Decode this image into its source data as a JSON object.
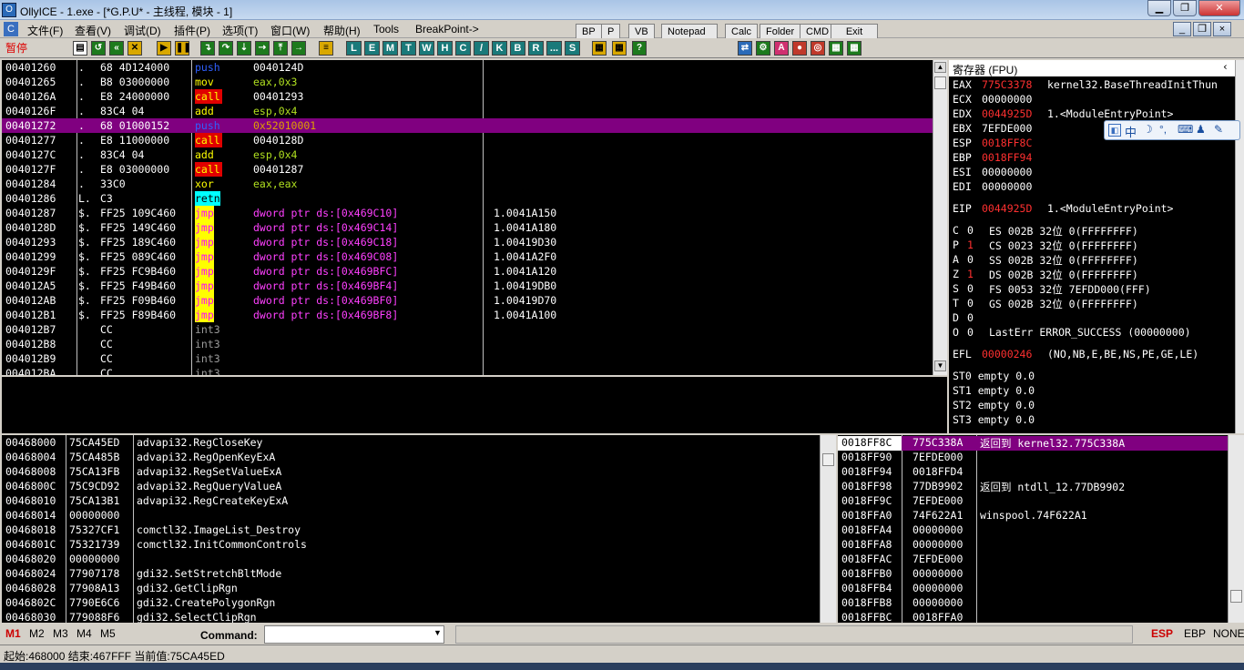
{
  "window": {
    "title": "OllyICE - 1.exe - [*G.P.U* - 主线程, 模块 - 1]"
  },
  "menu": [
    "文件(F)",
    "查看(V)",
    "调试(D)",
    "插件(P)",
    "选项(T)",
    "窗口(W)",
    "帮助(H)",
    "Tools",
    "BreakPoint->"
  ],
  "top_buttons": [
    "BP",
    "P",
    "VB",
    "Notepad",
    "Calc",
    "Folder",
    "CMD",
    "Exit"
  ],
  "status_state": "暂停",
  "toolbar_letters": [
    "L",
    "E",
    "M",
    "T",
    "W",
    "H",
    "C",
    "/",
    "K",
    "B",
    "R",
    "...",
    "S"
  ],
  "disasm": [
    {
      "addr": "00401260",
      "mark": ".",
      "hex": "68 4D124000",
      "mn": "push",
      "op": "0040124D",
      "cm": "",
      "style": "push"
    },
    {
      "addr": "00401265",
      "mark": ".",
      "hex": "B8 03000000",
      "mn": "mov",
      "op": "eax,0x3",
      "cm": "",
      "style": "plain"
    },
    {
      "addr": "0040126A",
      "mark": ".",
      "hex": "E8 24000000",
      "mn": "call",
      "op": "00401293",
      "cm": "",
      "style": "call"
    },
    {
      "addr": "0040126F",
      "mark": ".",
      "hex": "83C4 04",
      "mn": "add",
      "op": "esp,0x4",
      "cm": "",
      "style": "plain"
    },
    {
      "addr": "00401272",
      "mark": ".",
      "hex": "68 01000152",
      "mn": "push",
      "op": "0x52010001",
      "cm": "",
      "style": "sel"
    },
    {
      "addr": "00401277",
      "mark": ".",
      "hex": "E8 11000000",
      "mn": "call",
      "op": "0040128D",
      "cm": "",
      "style": "call"
    },
    {
      "addr": "0040127C",
      "mark": ".",
      "hex": "83C4 04",
      "mn": "add",
      "op": "esp,0x4",
      "cm": "",
      "style": "plain"
    },
    {
      "addr": "0040127F",
      "mark": ".",
      "hex": "E8 03000000",
      "mn": "call",
      "op": "00401287",
      "cm": "",
      "style": "call"
    },
    {
      "addr": "00401284",
      "mark": ".",
      "hex": "33C0",
      "mn": "xor",
      "op": "eax,eax",
      "cm": "",
      "style": "plain"
    },
    {
      "addr": "00401286",
      "mark": "L.",
      "hex": "C3",
      "mn": "retn",
      "op": "",
      "cm": "",
      "style": "retn"
    },
    {
      "addr": "00401287",
      "mark": "$.",
      "hex": "FF25 109C460",
      "mn": "jmp",
      "op": "dword ptr ds:[0x469C10]",
      "cm": "1.0041A150",
      "style": "jmp"
    },
    {
      "addr": "0040128D",
      "mark": "$.",
      "hex": "FF25 149C460",
      "mn": "jmp",
      "op": "dword ptr ds:[0x469C14]",
      "cm": "1.0041A180",
      "style": "jmp"
    },
    {
      "addr": "00401293",
      "mark": "$.",
      "hex": "FF25 189C460",
      "mn": "jmp",
      "op": "dword ptr ds:[0x469C18]",
      "cm": "1.00419D30",
      "style": "jmp"
    },
    {
      "addr": "00401299",
      "mark": "$.",
      "hex": "FF25 089C460",
      "mn": "jmp",
      "op": "dword ptr ds:[0x469C08]",
      "cm": "1.0041A2F0",
      "style": "jmp"
    },
    {
      "addr": "0040129F",
      "mark": "$.",
      "hex": "FF25 FC9B460",
      "mn": "jmp",
      "op": "dword ptr ds:[0x469BFC]",
      "cm": "1.0041A120",
      "style": "jmp"
    },
    {
      "addr": "004012A5",
      "mark": "$.",
      "hex": "FF25 F49B460",
      "mn": "jmp",
      "op": "dword ptr ds:[0x469BF4]",
      "cm": "1.00419DB0",
      "style": "jmp"
    },
    {
      "addr": "004012AB",
      "mark": "$.",
      "hex": "FF25 F09B460",
      "mn": "jmp",
      "op": "dword ptr ds:[0x469BF0]",
      "cm": "1.00419D70",
      "style": "jmp"
    },
    {
      "addr": "004012B1",
      "mark": "$.",
      "hex": "FF25 F89B460",
      "mn": "jmp",
      "op": "dword ptr ds:[0x469BF8]",
      "cm": "1.0041A100",
      "style": "jmp"
    },
    {
      "addr": "004012B7",
      "mark": "",
      "hex": "CC",
      "mn": "int3",
      "op": "",
      "cm": "",
      "style": "int3"
    },
    {
      "addr": "004012B8",
      "mark": "",
      "hex": "CC",
      "mn": "int3",
      "op": "",
      "cm": "",
      "style": "int3"
    },
    {
      "addr": "004012B9",
      "mark": "",
      "hex": "CC",
      "mn": "int3",
      "op": "",
      "cm": "",
      "style": "int3"
    },
    {
      "addr": "004012BA",
      "mark": "",
      "hex": "CC",
      "mn": "int3",
      "op": "",
      "cm": "",
      "style": "int3"
    }
  ],
  "registers": {
    "header": "寄存器 (FPU)",
    "rows": [
      {
        "n": "EAX",
        "v": "775C3378",
        "red": true,
        "c": "kernel32.BaseThreadInitThun"
      },
      {
        "n": "ECX",
        "v": "00000000",
        "red": false,
        "c": ""
      },
      {
        "n": "EDX",
        "v": "0044925D",
        "red": true,
        "c": "1.<ModuleEntryPoint>"
      },
      {
        "n": "EBX",
        "v": "7EFDE000",
        "red": false,
        "c": ""
      },
      {
        "n": "ESP",
        "v": "0018FF8C",
        "red": true,
        "c": ""
      },
      {
        "n": "EBP",
        "v": "0018FF94",
        "red": true,
        "c": ""
      },
      {
        "n": "ESI",
        "v": "00000000",
        "red": false,
        "c": ""
      },
      {
        "n": "EDI",
        "v": "00000000",
        "red": false,
        "c": ""
      },
      {
        "n": "",
        "v": "",
        "red": false,
        "c": ""
      },
      {
        "n": "EIP",
        "v": "0044925D",
        "red": true,
        "c": "1.<ModuleEntryPoint>"
      },
      {
        "n": "",
        "v": "",
        "red": false,
        "c": ""
      }
    ],
    "flags": [
      {
        "f": "C",
        "v": "0",
        "red": false,
        "s": "ES 002B 32位 0(FFFFFFFF)"
      },
      {
        "f": "P",
        "v": "1",
        "red": true,
        "s": "CS 0023 32位 0(FFFFFFFF)"
      },
      {
        "f": "A",
        "v": "0",
        "red": false,
        "s": "SS 002B 32位 0(FFFFFFFF)"
      },
      {
        "f": "Z",
        "v": "1",
        "red": true,
        "s": "DS 002B 32位 0(FFFFFFFF)"
      },
      {
        "f": "S",
        "v": "0",
        "red": false,
        "s": "FS 0053 32位 7EFDD000(FFF)"
      },
      {
        "f": "T",
        "v": "0",
        "red": false,
        "s": "GS 002B 32位 0(FFFFFFFF)"
      },
      {
        "f": "D",
        "v": "0",
        "red": false,
        "s": ""
      },
      {
        "f": "O",
        "v": "0",
        "red": false,
        "s": "LastErr ERROR_SUCCESS (00000000)"
      }
    ],
    "efl": {
      "n": "EFL",
      "v": "00000246",
      "s": "(NO,NB,E,BE,NS,PE,GE,LE)"
    },
    "fpu": [
      "ST0 empty 0.0",
      "ST1 empty 0.0",
      "ST2 empty 0.0",
      "ST3 empty 0.0"
    ]
  },
  "dump": [
    {
      "a": "00468000",
      "v": "75CA45ED",
      "t": "advapi32.RegCloseKey"
    },
    {
      "a": "00468004",
      "v": "75CA485B",
      "t": "advapi32.RegOpenKeyExA"
    },
    {
      "a": "00468008",
      "v": "75CA13FB",
      "t": "advapi32.RegSetValueExA"
    },
    {
      "a": "0046800C",
      "v": "75C9CD92",
      "t": "advapi32.RegQueryValueA"
    },
    {
      "a": "00468010",
      "v": "75CA13B1",
      "t": "advapi32.RegCreateKeyExA"
    },
    {
      "a": "00468014",
      "v": "00000000",
      "t": ""
    },
    {
      "a": "00468018",
      "v": "75327CF1",
      "t": "comctl32.ImageList_Destroy"
    },
    {
      "a": "0046801C",
      "v": "75321739",
      "t": "comctl32.InitCommonControls"
    },
    {
      "a": "00468020",
      "v": "00000000",
      "t": ""
    },
    {
      "a": "00468024",
      "v": "77907178",
      "t": "gdi32.SetStretchBltMode"
    },
    {
      "a": "00468028",
      "v": "77908A13",
      "t": "gdi32.GetClipRgn"
    },
    {
      "a": "0046802C",
      "v": "7790E6C6",
      "t": "gdi32.CreatePolygonRgn"
    },
    {
      "a": "00468030",
      "v": "779088F6",
      "t": "gdi32.SelectClipRgn"
    }
  ],
  "stack": [
    {
      "a": "0018FF8C",
      "v": "775C338A",
      "t": "返回到 kernel32.775C338A",
      "sel": true
    },
    {
      "a": "0018FF90",
      "v": "7EFDE000",
      "t": "",
      "sel": false
    },
    {
      "a": "0018FF94",
      "v": "0018FFD4",
      "t": "",
      "sel": false
    },
    {
      "a": "0018FF98",
      "v": "77DB9902",
      "t": "返回到 ntdll_12.77DB9902",
      "sel": false
    },
    {
      "a": "0018FF9C",
      "v": "7EFDE000",
      "t": "",
      "sel": false
    },
    {
      "a": "0018FFA0",
      "v": "74F622A1",
      "t": "winspool.74F622A1",
      "sel": false
    },
    {
      "a": "0018FFA4",
      "v": "00000000",
      "t": "",
      "sel": false
    },
    {
      "a": "0018FFA8",
      "v": "00000000",
      "t": "",
      "sel": false
    },
    {
      "a": "0018FFAC",
      "v": "7EFDE000",
      "t": "",
      "sel": false
    },
    {
      "a": "0018FFB0",
      "v": "00000000",
      "t": "",
      "sel": false
    },
    {
      "a": "0018FFB4",
      "v": "00000000",
      "t": "",
      "sel": false
    },
    {
      "a": "0018FFB8",
      "v": "00000000",
      "t": "",
      "sel": false
    },
    {
      "a": "0018FFBC",
      "v": "0018FFA0",
      "t": "",
      "sel": false
    }
  ],
  "cmd": {
    "tabs": [
      "M1",
      "M2",
      "M3",
      "M4",
      "M5"
    ],
    "label": "Command:",
    "value": "",
    "right": [
      "ESP",
      "EBP",
      "NONE"
    ]
  },
  "status": "起始:468000 结束:467FFF 当前值:75CA45ED",
  "ime": "中"
}
